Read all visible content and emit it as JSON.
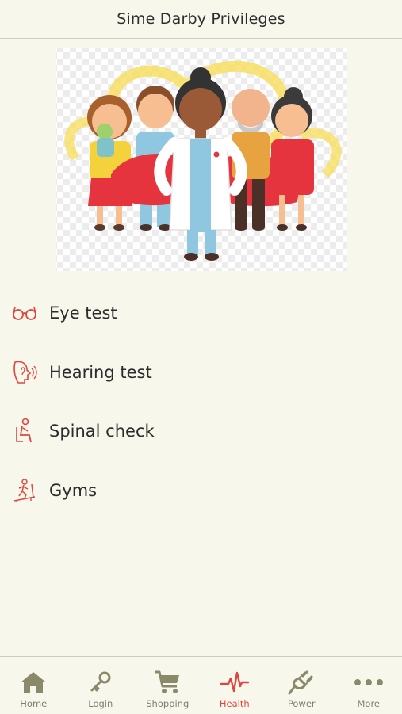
{
  "header": {
    "title": "Sime Darby Privileges"
  },
  "menu": {
    "items": [
      {
        "label": "Eye test",
        "icon": "eye-glasses-icon"
      },
      {
        "label": "Hearing test",
        "icon": "hearing-icon"
      },
      {
        "label": "Spinal check",
        "icon": "spinal-icon"
      },
      {
        "label": "Gyms",
        "icon": "treadmill-icon"
      }
    ]
  },
  "tabbar": {
    "tabs": [
      {
        "label": "Home",
        "icon": "home-icon"
      },
      {
        "label": "Login",
        "icon": "key-icon"
      },
      {
        "label": "Shopping",
        "icon": "cart-icon"
      },
      {
        "label": "Health",
        "icon": "heartbeat-icon",
        "active": true
      },
      {
        "label": "Power",
        "icon": "plug-icon"
      },
      {
        "label": "More",
        "icon": "more-dots-icon"
      }
    ]
  },
  "colors": {
    "accent": "#e0463f",
    "tab_icon": "#8a8a6a",
    "background": "#f8f7ec"
  }
}
